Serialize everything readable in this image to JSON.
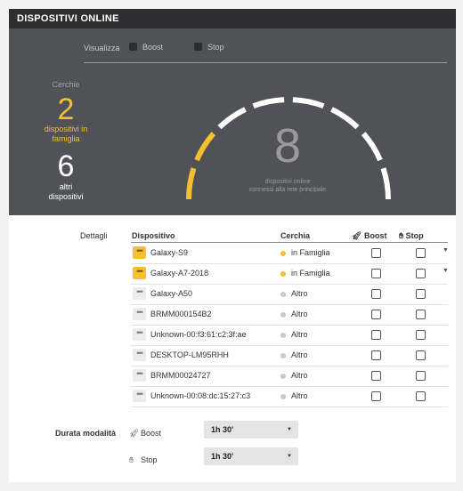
{
  "header": {
    "title": "DISPOSITIVI ONLINE"
  },
  "filter": {
    "label": "Visualizza",
    "options": [
      "Boost",
      "Stop"
    ]
  },
  "stats": {
    "cerchie_label": "Cerchie",
    "family_count": "2",
    "family_desc_line1": "dispositivi in",
    "family_desc_line2": "famiglia",
    "other_count": "6",
    "other_desc_line1": "altri",
    "other_desc_line2": "dispositivi"
  },
  "gauge": {
    "total": "8",
    "caption_line1": "dispositivi online",
    "caption_line2": "connessi alla rete principale",
    "segments_total": 8,
    "segments_highlighted": 2,
    "highlight_color": "#f5c02f",
    "base_color": "#ffffff"
  },
  "details": {
    "label": "Dettagli",
    "columns": {
      "device": "Dispositivo",
      "circle": "Cerchia",
      "boost": "Boost",
      "stop": "Stop"
    },
    "rows": [
      {
        "name": "Galaxy-S9",
        "circle": "in Famiglia",
        "family": true,
        "expandable": true
      },
      {
        "name": "Galaxy-A7-2018",
        "circle": "in Famiglia",
        "family": true,
        "expandable": true
      },
      {
        "name": "Galaxy-A50",
        "circle": "Altro",
        "family": false,
        "expandable": false
      },
      {
        "name": "BRMM000154B2",
        "circle": "Altro",
        "family": false,
        "expandable": false
      },
      {
        "name": "Unknown-00:f3:61:c2:3f:ae",
        "circle": "Altro",
        "family": false,
        "expandable": false
      },
      {
        "name": "DESKTOP-LM95RHH",
        "circle": "Altro",
        "family": false,
        "expandable": false
      },
      {
        "name": "BRMM00024727",
        "circle": "Altro",
        "family": false,
        "expandable": false
      },
      {
        "name": "Unknown-00:08:dc:15:27:c3",
        "circle": "Altro",
        "family": false,
        "expandable": false
      }
    ]
  },
  "duration": {
    "label": "Durata modalità",
    "boost": {
      "label": "Boost",
      "value": "1h 30'"
    },
    "stop": {
      "label": "Stop",
      "value": "1h 30'"
    }
  },
  "colors": {
    "accent": "#f5c02f",
    "dark_panel": "#505257",
    "header": "#2f2f31"
  }
}
